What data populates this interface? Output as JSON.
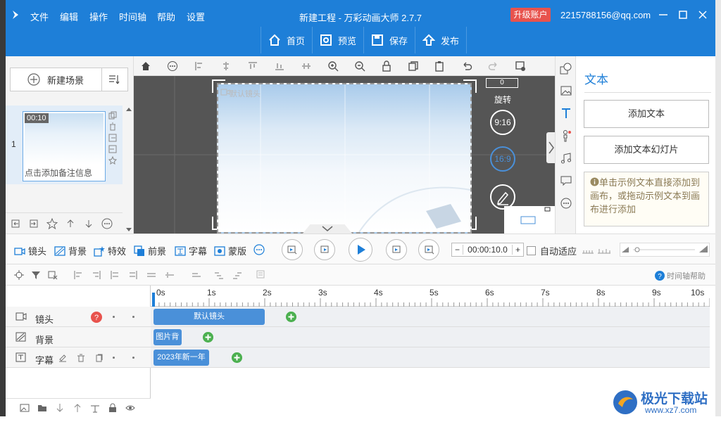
{
  "titlebar": {
    "menus": [
      "文件",
      "编辑",
      "操作",
      "时间轴",
      "帮助",
      "设置"
    ],
    "title": "新建工程 - 万彩动画大师 2.7.7",
    "upgrade": "升级账户",
    "account": "2215788156@qq.com"
  },
  "main_toolbar": {
    "home": "首页",
    "preview": "预览",
    "save": "保存",
    "publish": "发布"
  },
  "scenes": {
    "new_scene": "新建场景",
    "items": [
      {
        "number": "1",
        "duration": "00:10",
        "note": "点击添加备注信息"
      }
    ]
  },
  "canvas": {
    "stage_label": "默认镜头",
    "rotation_value": "0",
    "rotation_label": "旋转",
    "ratio_916": "9:16",
    "ratio_169": "16:9"
  },
  "text_panel": {
    "title": "文本",
    "add_text": "添加文本",
    "add_text_slide": "添加文本幻灯片",
    "tip": "单击示例文本直接添加到画布，或拖动示例文本到画布进行添加"
  },
  "timeline_toolbar": {
    "camera": "镜头",
    "background": "背景",
    "effects": "特效",
    "foreground": "前景",
    "subtitle": "字幕",
    "mask": "蒙版",
    "time_value": "00:00:10.0",
    "auto_fit": "自动适应",
    "help": "时间轴帮助"
  },
  "timeline": {
    "ticks": [
      "0s",
      "1s",
      "2s",
      "3s",
      "4s",
      "5s",
      "6s",
      "7s",
      "8s",
      "9s",
      "10s"
    ],
    "tracks": [
      {
        "name": "镜头",
        "clip": "默认镜头",
        "clip_start": 0,
        "clip_end": 2
      },
      {
        "name": "背景",
        "clip": "图片背",
        "clip_start": 0,
        "clip_end": 0.5
      },
      {
        "name": "字幕",
        "clip": "2023年新一年",
        "clip_start": 0,
        "clip_end": 1
      }
    ]
  },
  "watermark": {
    "name": "极光下载站",
    "url": "www.xz7.com"
  },
  "colors": {
    "accent": "#1e7fd8",
    "upgrade": "#e8534d",
    "clip": "#4a90d9",
    "add": "#4cb050"
  }
}
